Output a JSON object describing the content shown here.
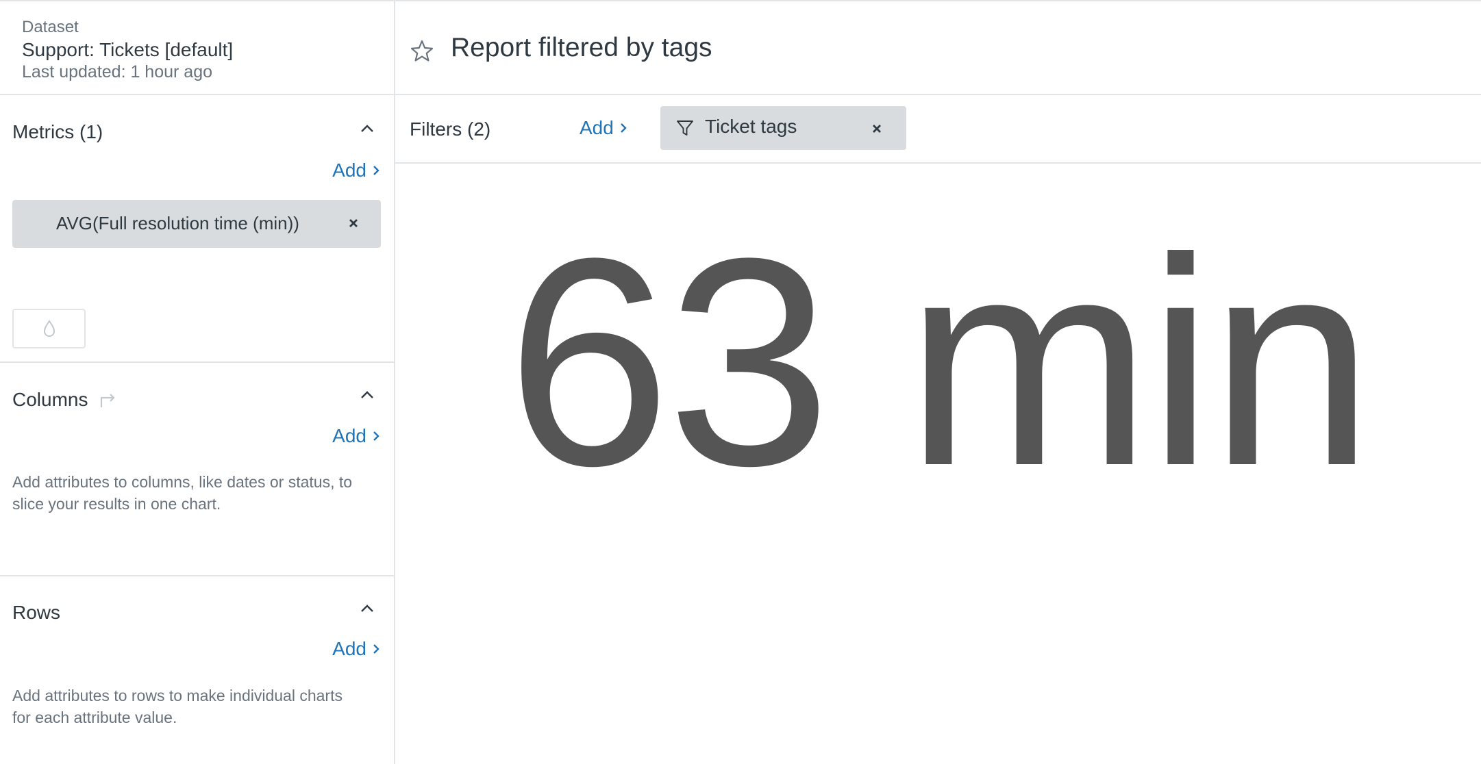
{
  "dataset": {
    "caption": "Dataset",
    "name": "Support: Tickets [default]",
    "updated": "Last updated: 1 hour ago"
  },
  "metrics": {
    "title": "Metrics (1)",
    "add_label": "Add",
    "items": [
      {
        "label": "AVG(Full resolution time (min))"
      }
    ]
  },
  "columns": {
    "title": "Columns",
    "add_label": "Add",
    "hint": "Add attributes to columns, like dates or status, to slice your results in one chart."
  },
  "rows": {
    "title": "Rows",
    "add_label": "Add",
    "hint": "Add attributes to rows to make individual charts for each attribute value."
  },
  "report": {
    "title": "Report filtered by tags"
  },
  "filters": {
    "label": "Filters (2)",
    "add_label": "Add",
    "items": [
      {
        "label": "Ticket tags"
      }
    ]
  },
  "kpi": {
    "value": "63 min",
    "color": "#555555"
  },
  "colors": {
    "accent": "#1f73b7",
    "pill_bg": "#d8dcde",
    "divider": "#e2e5e8"
  },
  "icons": {
    "collapse": "chevron-up-icon",
    "swap": "swap-icon",
    "favorite": "star-icon",
    "filter": "funnel-icon",
    "remove": "close-icon",
    "color": "droplet-icon"
  }
}
